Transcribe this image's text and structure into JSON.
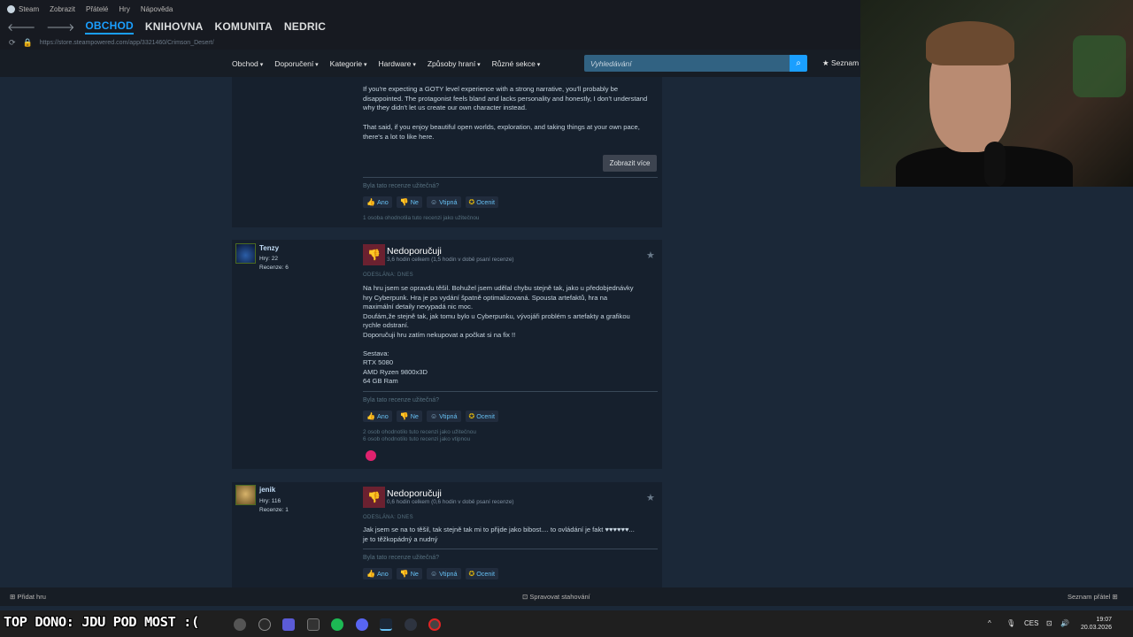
{
  "menubar": {
    "items": [
      "Steam",
      "Zobrazit",
      "Přátelé",
      "Hry",
      "Nápověda"
    ]
  },
  "nav": {
    "tabs": [
      "OBCHOD",
      "KNIHOVNA",
      "KOMUNITA",
      "NEDRIC"
    ],
    "url": "https://store.steampowered.com/app/3321460/Crimson_Desert/"
  },
  "store": {
    "menu": [
      "Obchod",
      "Doporučení",
      "Kategorie",
      "Hardware",
      "Způsoby hraní",
      "Různé sekce"
    ],
    "search_placeholder": "Vyhledávání",
    "wishlist": "Seznam"
  },
  "review0": {
    "p1": "If you're expecting a GOTY level experience with a strong narrative, you'll probably be disappointed. The protagonist feels bland and lacks personality and honestly, I don't understand why they didn't let us create our own character instead.",
    "p2": "That said, if you enjoy beautiful open worlds, exploration, and taking things at your own pace, there's a lot to like here.",
    "more": "Zobrazit více",
    "helpful_q": "Byla tato recenze užitečná?",
    "stats": [
      "1 osoba ohodnotila tuto recenzi jako užitečnou"
    ]
  },
  "vote": {
    "yes": "Ano",
    "no": "Ne",
    "funny": "Vtipná",
    "award": "Ocenit"
  },
  "review1": {
    "user": "Tenzy",
    "games": "Hry: 22",
    "reviews": "Recenze: 6",
    "verdict": "Nedoporučuji",
    "hours": "3,6 hodin celkem (1,5 hodin v době psaní recenze)",
    "posted": "ODESLÁNA: DNES",
    "lines": [
      "Na hru jsem se opravdu těšil. Bohužel jsem udělal chybu stejně tak, jako u předobjednávky",
      "hry Cyberpunk. Hra je po vydání špatně optimalizovaná. Spousta artefaktů, hra na",
      "maximální detaily nevypadá nic moc.",
      "Doufám,že stejně tak, jak tomu bylo u Cyberpunku, vývojáři problém s artefakty a grafikou",
      "rychle odstraní.",
      "Doporučuji hru zatím nekupovat a počkat si na fix !!",
      "",
      "Sestava:",
      "RTX 5080",
      "AMD Ryzen 9800x3D",
      "64 GB Ram"
    ],
    "helpful_q": "Byla tato recenze užitečná?",
    "stats": [
      "2 osob ohodnotilo tuto recenzi jako užitečnou",
      "6 osob ohodnotilo tuto recenzi jako vtipnou"
    ]
  },
  "review2": {
    "user": "jenik",
    "games": "Hry: 116",
    "reviews": "Recenze: 1",
    "verdict": "Nedoporučuji",
    "hours": "0,6 hodin celkem (0,6 hodin v době psaní recenze)",
    "posted": "ODESLÁNA: DNES",
    "lines": [
      "Jak jsem se na to těšil, tak stejně tak mi to přijde jako bibost.... to ovládání je fakt ♥♥♥♥♥♥...",
      "je to těžkopádný a nudný"
    ],
    "helpful_q": "Byla tato recenze užitečná?"
  },
  "bottombar": {
    "add_game": "Přidat hru",
    "downloads": "Spravovat stahování",
    "friends": "Seznam přátel"
  },
  "taskbar": {
    "donate": "TOP DONO: JDU POD MOST :(",
    "lang": "CES",
    "time": "19:07",
    "date": "20.03.2026"
  },
  "colors": {
    "bg": "#1b2838",
    "accent": "#1a9fff",
    "link": "#66c0f4",
    "negative": "#6b2130"
  }
}
